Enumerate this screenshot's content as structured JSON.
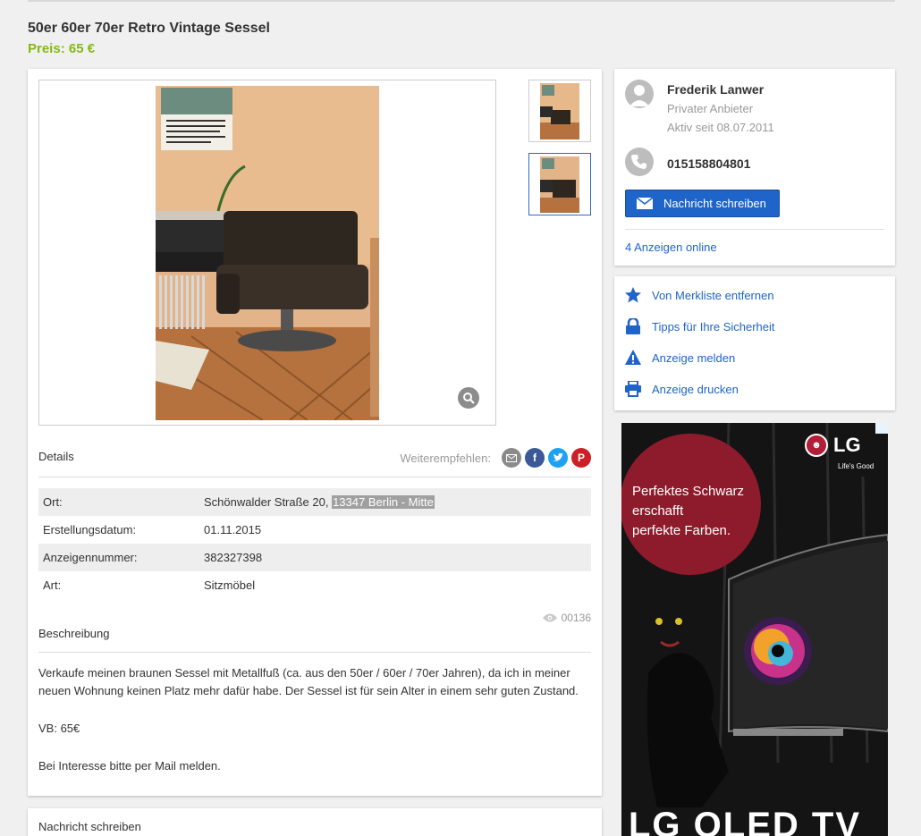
{
  "listing": {
    "title": "50er 60er 70er Retro Vintage Sessel",
    "price": "Preis: 65 €"
  },
  "gallery": {
    "zoom_icon": "magnifier-icon",
    "thumb_count": 2
  },
  "details": {
    "heading": "Details",
    "share_label": "Weiterempfehlen:",
    "rows": [
      {
        "key": "Ort:",
        "value": "Schönwalder Straße 20, ",
        "value_highlight": "13347 Berlin - Mitte"
      },
      {
        "key": "Erstellungsdatum:",
        "value": "01.11.2015"
      },
      {
        "key": "Anzeigennummer:",
        "value": "382327398"
      },
      {
        "key": "Art:",
        "value": "Sitzmöbel"
      }
    ]
  },
  "views": "00136",
  "description": {
    "heading": "Beschreibung",
    "paragraphs": [
      "Verkaufe meinen braunen Sessel mit Metallfuß (ca. aus den 50er / 60er / 70er Jahren), da ich in meiner neuen Wohnung keinen Platz mehr dafür habe. Der Sessel ist für sein Alter in einem sehr guten Zustand.",
      "VB: 65€",
      "Bei Interesse bitte per Mail melden."
    ]
  },
  "message_section": {
    "heading": "Nachricht schreiben"
  },
  "seller": {
    "name": "Frederik Lanwer",
    "type": "Privater Anbieter",
    "active_since": "Aktiv seit 08.07.2011",
    "phone": "015158804801",
    "message_button": "Nachricht schreiben",
    "ads_online": "4 Anzeigen online"
  },
  "side_links": [
    {
      "label": "Von Merkliste entfernen",
      "icon": "star-icon"
    },
    {
      "label": "Tipps für Ihre Sicherheit",
      "icon": "lock-icon"
    },
    {
      "label": "Anzeige melden",
      "icon": "warning-icon"
    },
    {
      "label": "Anzeige drucken",
      "icon": "printer-icon"
    }
  ],
  "banner": {
    "slogan_lines": [
      "Perfektes Schwarz",
      "erschafft",
      "perfekte Farben."
    ],
    "brand": "LG",
    "brand_sub": "Life's Good",
    "product": "LG OLED TV"
  },
  "colors": {
    "price": "#86b817",
    "link": "#1f64c8",
    "button": "#1f64c8"
  }
}
